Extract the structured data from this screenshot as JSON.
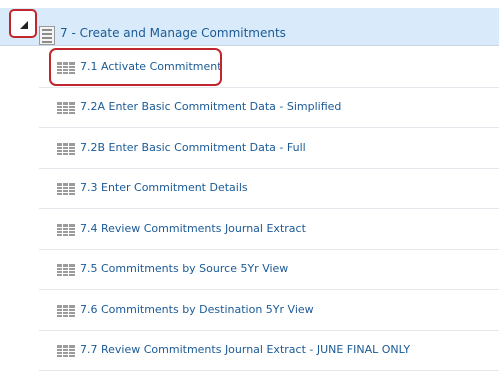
{
  "parent": {
    "label": "7 - Create and Manage Commitments",
    "toggle_icon": "collapse-triangle-icon",
    "icon": "document-list-icon"
  },
  "children": [
    {
      "label": "7.1 Activate Commitment",
      "icon": "grid-report-icon"
    },
    {
      "label": "7.2A Enter Basic Commitment Data - Simplified",
      "icon": "grid-report-icon"
    },
    {
      "label": "7.2B Enter Basic Commitment Data - Full",
      "icon": "grid-report-icon"
    },
    {
      "label": "7.3 Enter Commitment Details",
      "icon": "grid-report-icon"
    },
    {
      "label": "7.4 Review Commitments Journal Extract",
      "icon": "grid-report-icon"
    },
    {
      "label": "7.5 Commitments by Source 5Yr View",
      "icon": "grid-report-icon"
    },
    {
      "label": "7.6 Commitments by Destination 5Yr View",
      "icon": "grid-report-icon"
    },
    {
      "label": "7.7 Review Commitments Journal Extract - JUNE FINAL ONLY",
      "icon": "grid-report-icon"
    }
  ],
  "colors": {
    "link": "#1b5a96",
    "selected_row": "#d9ebfa",
    "callout": "#c0272d"
  }
}
